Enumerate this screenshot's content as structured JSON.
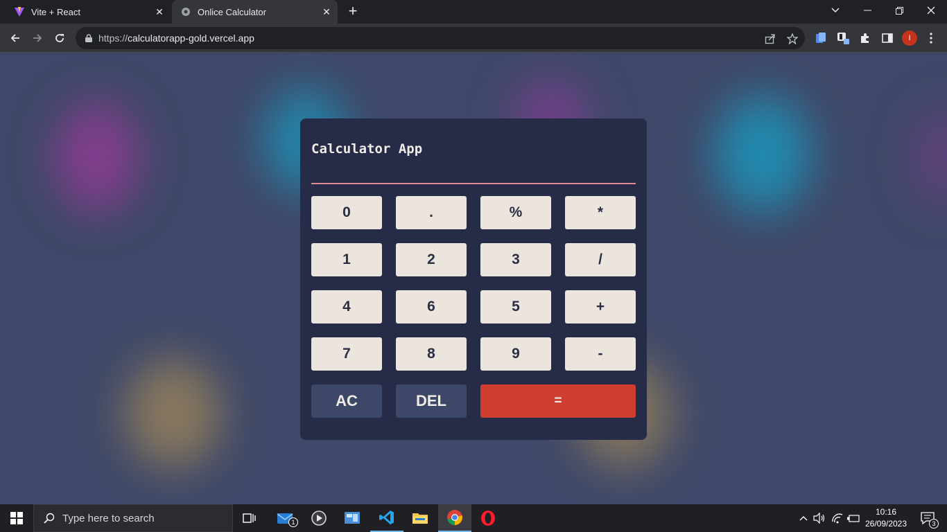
{
  "browser": {
    "tabs": [
      {
        "title": "Vite + React",
        "icon": "vite-icon",
        "active": false
      },
      {
        "title": "Onlice Calculator",
        "icon": "globe-icon",
        "active": true
      }
    ],
    "url_scheme": "https://",
    "url_host": "calculatorapp-gold.vercel.app",
    "profile_initial": "I"
  },
  "calculator": {
    "title": "Calculator App",
    "display_value": "",
    "keys": {
      "zero": "0",
      "dot": ".",
      "percent": "%",
      "multiply": "*",
      "one": "1",
      "two": "2",
      "three": "3",
      "divide": "/",
      "four": "4",
      "six": "6",
      "five": "5",
      "plus": "+",
      "seven": "7",
      "eight": "8",
      "nine": "9",
      "minus": "-",
      "clear": "AC",
      "delete": "DEL",
      "equals": "="
    },
    "colors": {
      "panel": "#262c47",
      "key": "#ece5de",
      "equals": "#d03e31",
      "accent_line": "#e08a92"
    }
  },
  "taskbar": {
    "search_placeholder": "Type here to search",
    "mail_badge": "1",
    "time": "10:16",
    "date": "26/09/2023",
    "notification_count": "3"
  }
}
